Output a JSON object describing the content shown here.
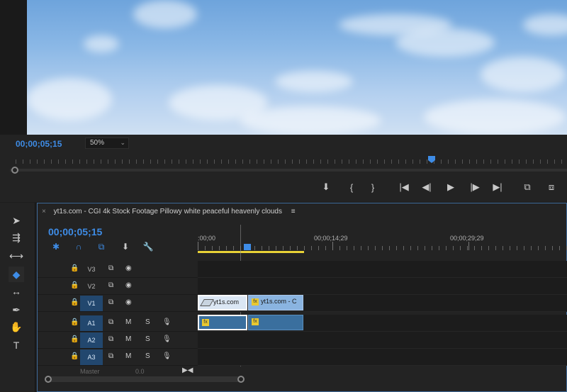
{
  "program_monitor": {
    "timecode": "00;00;05;15",
    "zoom": "50%",
    "transport_icons": [
      "marker-icon",
      "mark-in-icon",
      "mark-out-icon",
      "go-to-in-icon",
      "step-back-icon",
      "play-icon",
      "step-forward-icon",
      "go-to-out-icon",
      "lift-icon",
      "extract-icon"
    ],
    "transport_glyphs": [
      "⬇",
      "{",
      "}",
      "|◀",
      "◀|",
      "▶",
      "|▶",
      "▶|",
      "⧉",
      "⧈"
    ]
  },
  "tools": [
    {
      "name": "selection-tool-icon",
      "glyph": "➤",
      "active": false
    },
    {
      "name": "track-select-tool-icon",
      "glyph": "⇶",
      "active": false
    },
    {
      "name": "ripple-edit-tool-icon",
      "glyph": "⟷",
      "active": false
    },
    {
      "name": "razor-tool-icon",
      "glyph": "◆",
      "active": true
    },
    {
      "name": "slip-tool-icon",
      "glyph": "↔",
      "active": false
    },
    {
      "name": "pen-tool-icon",
      "glyph": "✒",
      "active": false
    },
    {
      "name": "hand-tool-icon",
      "glyph": "✋",
      "active": false
    },
    {
      "name": "type-tool-icon",
      "glyph": "T",
      "active": false
    }
  ],
  "timeline": {
    "tab_title": "yt1s.com -  CGI 4k Stock Footage  Pillowy white peaceful heavenly clouds",
    "close_glyph": "×",
    "menu_glyph": "≡",
    "timecode": "00;00;05;15",
    "ruler_labels": [
      ":00;00",
      "00;00;14;29",
      "00;00;29;29"
    ],
    "header_glyphs": {
      "lock": "🔒",
      "sync": "⧉",
      "eye": "◉",
      "m": "M",
      "s": "S",
      "mic": "🎙"
    },
    "tracks": [
      {
        "id": "v3",
        "label": "V3",
        "type": "video",
        "target": false
      },
      {
        "id": "v2",
        "label": "V2",
        "type": "video",
        "target": false
      },
      {
        "id": "v1",
        "label": "V1",
        "type": "video",
        "target": true
      },
      {
        "id": "a1",
        "label": "A1",
        "type": "audio",
        "target": true
      },
      {
        "id": "a2",
        "label": "A2",
        "type": "audio",
        "target": true
      },
      {
        "id": "a3",
        "label": "A3",
        "type": "audio",
        "target": true
      }
    ],
    "clips": {
      "v1_clip1": "yt1s.com",
      "v1_clip2": "yt1s.com - C",
      "fx": "fx"
    },
    "master_label": "Master",
    "master_value": "0.0",
    "end_glyph": "▶◀"
  }
}
